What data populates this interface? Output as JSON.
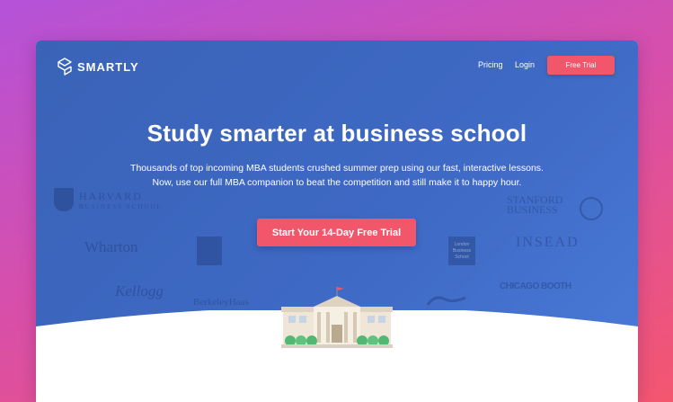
{
  "brand": {
    "name": "SMARTLY"
  },
  "nav": {
    "pricing": "Pricing",
    "login": "Login",
    "free_trial": "Free Trial"
  },
  "hero": {
    "headline": "Study smarter at business school",
    "sub_line1": "Thousands of top incoming MBA students crushed summer prep using our fast, interactive lessons.",
    "sub_line2": "Now, use our full MBA companion to beat the competition and still make it to happy hour.",
    "cta": "Start Your 14-Day Free Trial"
  },
  "schools": {
    "harvard_line1": "HARVARD",
    "harvard_line2": "BUSINESS SCHOOL",
    "wharton": "Wharton",
    "kellogg": "Kellogg",
    "berkeley": "BerkeleyHaas",
    "stanford_line1": "STANFORD",
    "stanford_line2": "BUSINESS",
    "insead": "INSEAD",
    "chicago": "CHICAGO BOOTH",
    "london_line1": "London",
    "london_line2": "Business",
    "london_line3": "School"
  },
  "colors": {
    "hero_blue": "#3e69c4",
    "accent_coral": "#f2566a",
    "page_gradient_start": "#b452d9",
    "page_gradient_end": "#f4566f"
  }
}
